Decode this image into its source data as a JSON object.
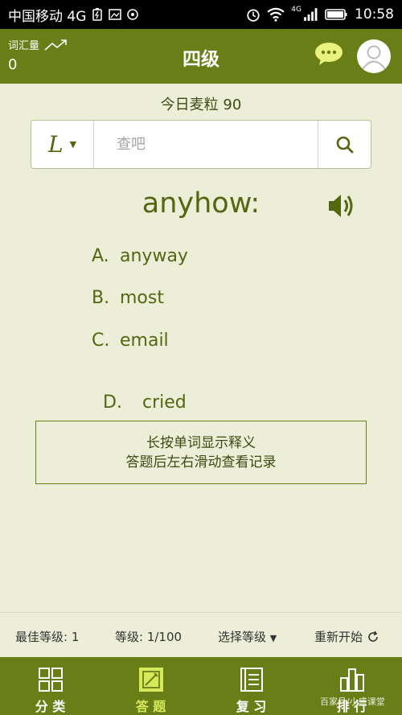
{
  "status": {
    "carrier": "中国移动 4G",
    "network": "4G",
    "time": "10:58"
  },
  "header": {
    "vocab_label": "词汇量",
    "vocab_count": "0",
    "title": "四级"
  },
  "daily_label": "今日麦粒 90",
  "search": {
    "lang": "L",
    "placeholder": "查吧"
  },
  "question": {
    "word": "anyhow:",
    "options": [
      {
        "letter": "A.",
        "text": "anyway"
      },
      {
        "letter": "B.",
        "text": "most"
      },
      {
        "letter": "C.",
        "text": "email"
      },
      {
        "letter": "D.",
        "text": "  cried"
      }
    ]
  },
  "hint": {
    "line1": "长按单词显示释义",
    "line2": "答题后左右滑动查看记录"
  },
  "level_bar": {
    "best_level": "最佳等级:  1",
    "level": "等级:  1/100",
    "select_level": "选择等级",
    "restart": "重新开始"
  },
  "nav": [
    {
      "label": "分 类",
      "icon": "grid-icon"
    },
    {
      "label": "答 题",
      "icon": "edit-icon"
    },
    {
      "label": "复 习",
      "icon": "book-icon"
    },
    {
      "label": "排 行",
      "icon": "ranking-icon"
    }
  ],
  "watermark": "百家号/小盛课堂",
  "colors": {
    "brand": "#6a7e17",
    "accent_text": "#556612",
    "background": "#eceed8",
    "active_nav": "#d6e95b"
  }
}
